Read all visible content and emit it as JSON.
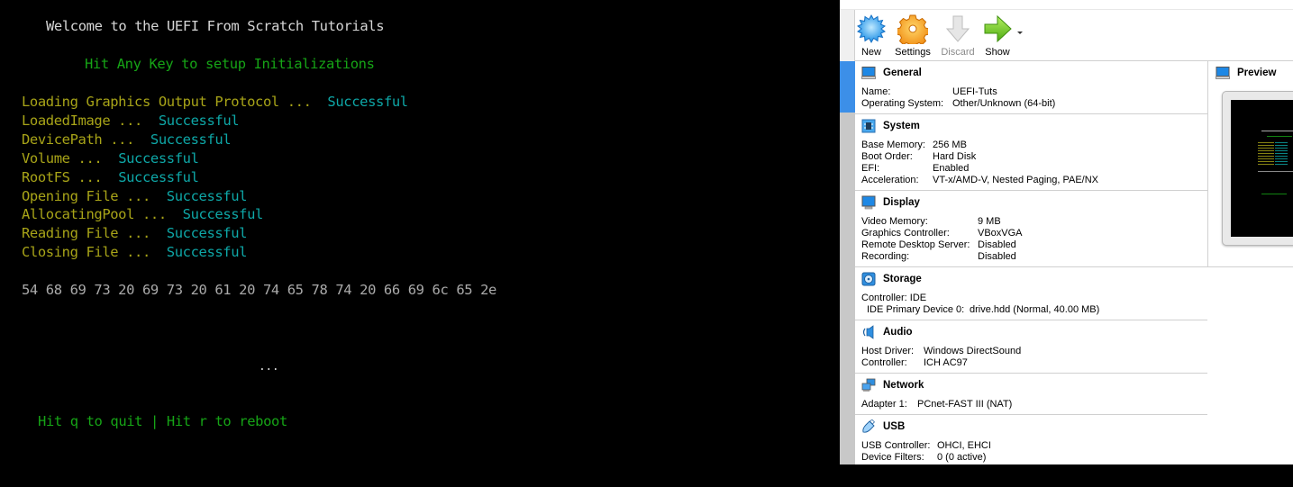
{
  "console": {
    "title_line": "Welcome to the UEFI From Scratch Tutorials",
    "prompt_line": "Hit Any Key to setup Initializations",
    "status_lines": [
      {
        "label": "Loading Graphics Output Protocol ... ",
        "status": "Successful"
      },
      {
        "label": "LoadedImage ... ",
        "status": "Successful"
      },
      {
        "label": "DevicePath ... ",
        "status": "Successful"
      },
      {
        "label": "Volume ... ",
        "status": "Successful"
      },
      {
        "label": "RootFS ... ",
        "status": "Successful"
      },
      {
        "label": "Opening File ... ",
        "status": "Successful"
      },
      {
        "label": "AllocatingPool ... ",
        "status": "Successful"
      },
      {
        "label": "Reading File ... ",
        "status": "Successful"
      },
      {
        "label": "Closing File ... ",
        "status": "Successful"
      }
    ],
    "hex_line": "54 68 69 73 20 69 73 20 61 20 74 65 78 74 20 66 69 6c 65 2e",
    "ellipsis": "...",
    "footer_line": "Hit q to quit | Hit r to reboot",
    "colors": {
      "title": "#d6d6d6",
      "prompt": "#16a416",
      "label": "#a8a418",
      "status": "#0ea7a7",
      "hex": "#aaaaaa"
    }
  },
  "toolbar": {
    "new_label": "New",
    "settings_label": "Settings",
    "discard_label": "Discard",
    "show_label": "Show"
  },
  "details": {
    "general": {
      "title": "General",
      "rows": [
        {
          "key": "Name:",
          "value": "UEFI-Tuts"
        },
        {
          "key": "Operating System:",
          "value": "Other/Unknown (64-bit)"
        }
      ]
    },
    "system": {
      "title": "System",
      "rows": [
        {
          "key": "Base Memory:",
          "value": "256 MB"
        },
        {
          "key": "Boot Order:",
          "value": "Hard Disk"
        },
        {
          "key": "EFI:",
          "value": "Enabled"
        },
        {
          "key": "Acceleration:",
          "value": "VT-x/AMD-V, Nested Paging, PAE/NX"
        }
      ]
    },
    "display": {
      "title": "Display",
      "rows": [
        {
          "key": "Video Memory:",
          "value": "9 MB"
        },
        {
          "key": "Graphics Controller:",
          "value": "VBoxVGA"
        },
        {
          "key": "Remote Desktop Server:",
          "value": "Disabled"
        },
        {
          "key": "Recording:",
          "value": "Disabled"
        }
      ]
    },
    "storage": {
      "title": "Storage",
      "rows": [
        {
          "key": "Controller: IDE",
          "value": ""
        },
        {
          "key": " IDE Primary Device 0:",
          "value": "drive.hdd (Normal, 40.00 MB)"
        }
      ]
    },
    "audio": {
      "title": "Audio",
      "rows": [
        {
          "key": "Host Driver:",
          "value": "Windows DirectSound"
        },
        {
          "key": "Controller:",
          "value": "ICH AC97"
        }
      ]
    },
    "network": {
      "title": "Network",
      "rows": [
        {
          "key": "Adapter 1:",
          "value": "PCnet-FAST III (NAT)"
        }
      ]
    },
    "usb": {
      "title": "USB",
      "rows": [
        {
          "key": "USB Controller:",
          "value": "OHCI, EHCI"
        },
        {
          "key": "Device Filters:",
          "value": "0 (0 active)"
        }
      ]
    }
  },
  "preview": {
    "title": "Preview"
  }
}
